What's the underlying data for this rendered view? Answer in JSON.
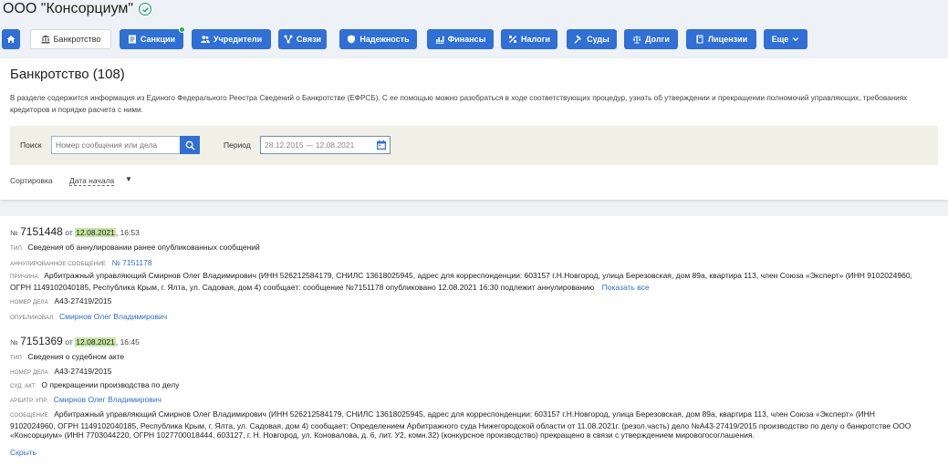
{
  "company": {
    "name": "ООО \"Консорциум\""
  },
  "nav": {
    "bankruptcy": "Банкротство",
    "sanctions": "Санкции",
    "founders": "Учредители",
    "links": "Связи",
    "reliability": "Надежность",
    "finance": "Финансы",
    "taxes": "Налоги",
    "courts": "Суды",
    "debts": "Долги",
    "licenses": "Лицензии",
    "more": "Еще"
  },
  "section": {
    "title": "Банкротство (108)",
    "description": "В разделе содержится информация из Единого Федерального Реестра Сведений о Банкротстве (ЕФРСБ). С ее помощью можно разобраться в ходе соответствующих процедур, узнать об утверждении и прекращении полномочий управляющих, требованиях кредиторов и порядке расчета с ними."
  },
  "filters": {
    "search_label": "Поиск",
    "search_placeholder": "Номер сообщения или дела",
    "period_label": "Период",
    "period_value": "28.12.2015 — 12.08.2021",
    "sort_label": "Сортировка",
    "sort_value": "Дата начала"
  },
  "messages": [
    {
      "num_prefix": "№",
      "number": "7151448",
      "ot": "от",
      "date": "12.08.2021",
      "time": ", 16:53",
      "type_key": "Тип",
      "type_val": "Сведения об аннулировании ранее опубликованных сообщений",
      "annulled_key": "Аннулированное сообщение",
      "annulled_val": "№ 7151178",
      "reason_key": "Причина",
      "reason_val": "Арбитражный управляющий Смирнов Олег Владимирович (ИНН 526212584179, СНИЛС 13618025945, адрес для корреспонденции: 603157 г.Н.Новгород, улица Березовская, дом 89а, квартира 113, член Союза «Эксперт» (ИНН 9102024960,  ОГРН 1149102040185, Республика Крым, г. Ялта, ул. Садовая, дом 4) сообщает: сообщение №7151178 опубликовано 12.08.2021 16:30 подлежит аннулированию",
      "show_all": "Показать все",
      "case_key": "Номер дела",
      "case_val": "А43-27419/2015",
      "published_key": "Опубликовал",
      "published_val": "Смирнов Олег Владимирович"
    },
    {
      "num_prefix": "№",
      "number": "7151369",
      "ot": "от",
      "date": "12.08.2021",
      "time": ", 16:45",
      "type_key": "Тип",
      "type_val": "Сведения о судебном акте",
      "case_key": "Номер дела",
      "case_val": "А43-27419/2015",
      "act_key": "Суд. акт",
      "act_val": "О прекращении производства по делу",
      "manager_key": "Арбитр. упр.",
      "manager_val": "Смирнов Олег Владимирович",
      "message_key": "Сообщение",
      "message_val": "Арбитражный управляющий Смирнов Олег Владимирович (ИНН 526212584179, СНИЛС 13618025945, адрес для корреспонденции: 603157 г.Н.Новгород, улица Березовская, дом 89а, квартира 113, член Союза «Эксперт» (ИНН 9102024960,  ОГРН 1149102040185, Республика Крым, г. Ялта, ул. Садовая, дом 4) сообщает: Определением Арбитражного суда Нижегородской области от 11.08.2021г. (резол.часть) дело №А43-27419/2015 производство по делу о банкротстве   ООО «Консорциум» (ИНН 7703044220, ОГРН 1027700018444, 603127, г. Н. Новгород, ул. Коновалова, д. 6, лит. У2, комн.32) (конкурсное производство) прекращено в связи с утверждением мировогосоглашения.",
      "hide": "Скрыть"
    }
  ]
}
